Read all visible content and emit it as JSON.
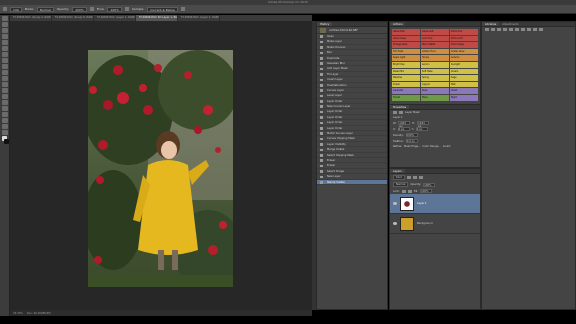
{
  "app": {
    "title": "Adobe Photoshop CC 2015"
  },
  "options_bar": {
    "tool": "Brush",
    "size": "130",
    "mode_label": "Mode:",
    "mode_value": "Normal",
    "opacity_label": "Opacity:",
    "opacity_value": "100%",
    "flow_label": "Flow:",
    "flow_value": "100%",
    "sample_label": "Sample:",
    "sample_value": "Current & Below"
  },
  "doc_tabs": [
    "5Y-KMUZ-ELIC (Snap) 4, RGB/8",
    "5Y-KMUZ-ELIC (Snap) 8, RGB/8",
    "5Y-KMUZ-ELIC (Layer 1, RGB/8) *",
    "5Y-KMUZ-ELIC 2D Layer 1, RGB/8",
    "5Y-KMUZ-ELIC (Layer 1, RGB/8)"
  ],
  "status": {
    "zoom": "33.33%",
    "doc": "Doc: 40.2M/88.6M"
  },
  "history": {
    "tab_title": "History",
    "snapshot": "untitled-DSC1166.NEF",
    "items": [
      "Open",
      "Make Layer",
      "Make Channel",
      "Blur",
      "Duplicate",
      "Gaussian Blur",
      "Add Layer Mask",
      "Fill Layer",
      "Invert Layer",
      "Hue/Saturation",
      "Curves Layer",
      "Level Layer",
      "Layer Order",
      "New Curves Layer",
      "Layer Order",
      "Layer Order",
      "Layer Order",
      "Layer Order",
      "Match Curves Layer",
      "Curves Clipping Mask",
      "Layer Visibility",
      "Merge Visible",
      "Select Clipping Mask",
      "Eraser",
      "Eraser",
      "Select Image",
      "New Layer",
      "Stamp Visible"
    ]
  },
  "actions": {
    "tab_title": "Actions",
    "buttons": [
      {
        "label": "Velvia Rich",
        "color": "#c04a45"
      },
      {
        "label": "Velvia Soft",
        "color": "#c04a45"
      },
      {
        "label": "Portra Full",
        "color": "#c04a45"
      },
      {
        "label": "Velvia Deep",
        "color": "#c04a45"
      },
      {
        "label": "Color Pop",
        "color": "#c04a45"
      },
      {
        "label": "Portra Soft",
        "color": "#c04a45"
      },
      {
        "label": "Vintage Rose",
        "color": "#c04a45"
      },
      {
        "label": "Warm Matte",
        "color": "#c04a45"
      },
      {
        "label": "Portra Deep",
        "color": "#c04a45"
      },
      {
        "label": "Film Fade",
        "color": "#d08f3e"
      },
      {
        "label": "Golden Hour",
        "color": "#d08f3e"
      },
      {
        "label": "Amber Glow",
        "color": "#d08f3e"
      },
      {
        "label": "Sepia Light",
        "color": "#d08f3e"
      },
      {
        "label": "Honey",
        "color": "#d08f3e"
      },
      {
        "label": "Autumn",
        "color": "#d08f3e"
      },
      {
        "label": "Bright Day",
        "color": "#cfc146"
      },
      {
        "label": "Lemon",
        "color": "#cfc146"
      },
      {
        "label": "Sunlight",
        "color": "#cfc146"
      },
      {
        "label": "Pastel Mix",
        "color": "#cfc146"
      },
      {
        "label": "Soft Haze",
        "color": "#cfc146"
      },
      {
        "label": "Cream",
        "color": "#cfc146"
      },
      {
        "label": "Meadow",
        "color": "#cfc146"
      },
      {
        "label": "Spring",
        "color": "#cfc146"
      },
      {
        "label": "Sage",
        "color": "#cfc146"
      },
      {
        "label": "Ocean",
        "color": "#cfc146"
      },
      {
        "label": "Lagoon",
        "color": "#cfc146"
      },
      {
        "label": "Mist",
        "color": "#cfc146"
      },
      {
        "label": "Lavender",
        "color": "#8a78b8"
      },
      {
        "label": "Dusk",
        "color": "#8a78b8"
      },
      {
        "label": "Violet",
        "color": "#8a78b8"
      },
      {
        "label": "Forest",
        "color": "#6e9a4a"
      },
      {
        "label": "Moss",
        "color": "#6e9a4a"
      },
      {
        "label": "Night",
        "color": "#8a78b8"
      }
    ]
  },
  "properties": {
    "tab_title": "Properties",
    "subtitle": "Layer Mask",
    "layer_name": "Layer 1",
    "w_label": "W:",
    "w_value": "1944 px",
    "h_label": "H:",
    "h_value": "1944 px",
    "x_label": "X:",
    "x_value": "0 px",
    "y_label": "Y:",
    "y_value": "0 px",
    "density_label": "Density:",
    "density_value": "100%",
    "feather_label": "Feather:",
    "feather_value": "0.0 px",
    "refine_label": "Refine:",
    "mask_edge": "Mask Edge...",
    "color_range": "Color Range...",
    "invert": "Invert"
  },
  "layers": {
    "tab_title": "Layers",
    "kind_label": "Kind",
    "blend_mode": "Normal",
    "opacity_label": "Opacity:",
    "opacity_value": "100%",
    "lock_label": "Lock:",
    "fill_label": "Fill:",
    "fill_value": "100%",
    "items": [
      {
        "name": "Layer 1",
        "selected": true
      },
      {
        "name": "Background",
        "selected": false
      }
    ]
  },
  "libraries": {
    "tab_title": "Libraries",
    "tab2": "Adjustments"
  }
}
